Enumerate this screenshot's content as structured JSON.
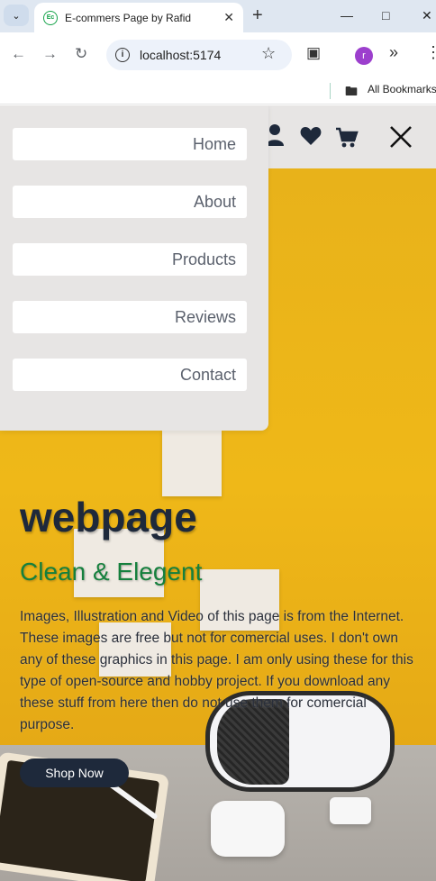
{
  "browser": {
    "tab_title": "E-commers Page by Rafid",
    "favicon_text": "Ec",
    "url": "localhost:5174",
    "profile_initial": "r",
    "bookmarks_label": "All Bookmarks"
  },
  "page": {
    "nav_items": [
      "Home",
      "About",
      "Products",
      "Reviews",
      "Contact"
    ],
    "hero": {
      "title": "webpage",
      "subtitle": "Clean & Elegent",
      "description": "Images, Illustration and Video of this page is from the Internet. These images are free but not for comercial uses. I don't own any of these graphics in this page. I am only using these for this type of open-source and hobby project. If you download any these stuff from here then do not use them for comercial purpose.",
      "cta_label": "Shop Now"
    },
    "header_icons": [
      "user-icon",
      "heart-icon",
      "cart-icon",
      "close-icon"
    ]
  },
  "colors": {
    "header_bg": "#e7e5e4",
    "hero_bg": "#e9b21a",
    "title": "#1e293b",
    "subtitle": "#15803d",
    "button_bg": "#1e293b",
    "nav_text": "#5b616d"
  }
}
